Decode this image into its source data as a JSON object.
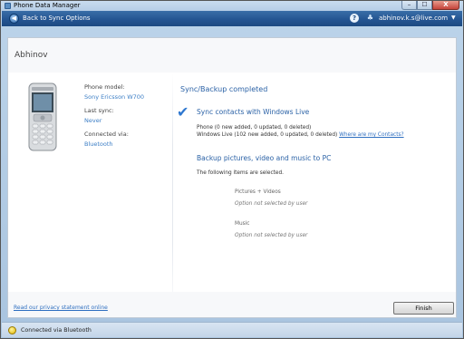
{
  "window": {
    "title": "Phone Data Manager",
    "min_label": "–",
    "max_label": "☐",
    "close_label": "X"
  },
  "nav": {
    "back_label": "Back to Sync Options",
    "help_label": "?",
    "account": "abhinov.k.s@live.com"
  },
  "profile": {
    "user_name": "Abhinov",
    "phone_model_label": "Phone model:",
    "phone_model": "Sony Ericsson W700",
    "last_sync_label": "Last sync:",
    "last_sync": "Never",
    "connected_via_label": "Connected via:",
    "connected_via": "Bluetooth"
  },
  "results": {
    "title": "Sync/Backup completed",
    "contacts_title": "Sync contacts with Windows Live",
    "contacts_phone": "Phone (0 new added, 0 updated, 0 deleted)",
    "contacts_live": "Windows Live (102 new added, 0 updated, 0 deleted)",
    "contacts_link": "Where are my Contacts?",
    "backup_title": "Backup pictures, video and music to PC",
    "backup_intro": "The following items are selected.",
    "backup_items": [
      {
        "name": "Pictures + Videos",
        "note": "Option not selected by user"
      },
      {
        "name": "Music",
        "note": "Option not selected by user"
      }
    ]
  },
  "footer": {
    "privacy_link": "Read our privacy statement online",
    "finish_label": "Finish"
  },
  "status": {
    "text": "Connected via Bluetooth"
  }
}
